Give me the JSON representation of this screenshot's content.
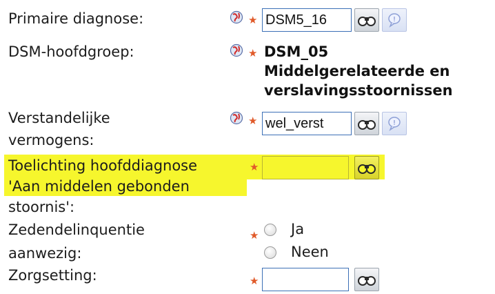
{
  "colors": {
    "highlight": "#f6f62d",
    "required": "#e05a2a",
    "field_border": "#3b6fb6"
  },
  "rows": {
    "primaire": {
      "label": "Primaire diagnose:",
      "value": "DSM5_16"
    },
    "hoofdgroep": {
      "label": "DSM-hoofdgroep:",
      "value_lines": [
        "DSM_05",
        "Middelgerelateerde en",
        "verslavingsstoornissen"
      ]
    },
    "verstandelijk": {
      "label_lines": [
        "Verstandelijke",
        "vermogens:"
      ],
      "value": "wel_verst"
    },
    "toelichting": {
      "label_lines": [
        "Toelichting hoofddiagnose",
        "'Aan middelen gebonden",
        "stoornis':"
      ],
      "value": ""
    },
    "zeden": {
      "label_lines": [
        "Zedendelinquentie",
        "aanwezig:"
      ],
      "options": [
        "Ja",
        "Neen"
      ]
    },
    "zorgsetting": {
      "label": "Zorgsetting:",
      "value": ""
    }
  },
  "icons": {
    "globe": "globe-icon",
    "binoculars": "binoculars-icon",
    "info": "info-icon",
    "required": "required-star-icon"
  }
}
